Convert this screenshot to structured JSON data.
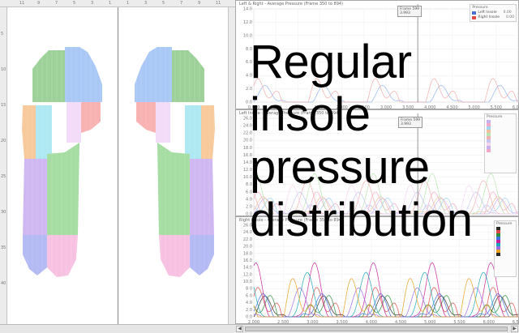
{
  "insole_map": {
    "top_ticks": [
      "11",
      "9",
      "7",
      "5",
      "3",
      "1",
      "1",
      "3",
      "5",
      "7",
      "9",
      "11"
    ],
    "left_ticks": [
      "5",
      "10",
      "15",
      "20",
      "25",
      "30",
      "35",
      "40"
    ],
    "zone_colors": {
      "toe_green": "#9ed19a",
      "toe_blue": "#a9c8f5",
      "met_orange": "#f8c99b",
      "met_cyan": "#aee8f2",
      "met_white": "#ffffff",
      "met_lavender": "#f2dcf7",
      "met_pink": "#f9b2b2",
      "mid_purple": "#cfb8f2",
      "mid_green": "#a5dda2",
      "heel_blue": "#b4baf3",
      "heel_pink": "#f7c2e2"
    }
  },
  "panes": {
    "top": {
      "title": "Left & Right - Average Pressure (Frame 350 to 894)",
      "y_ticks": [
        "14.0",
        "12.0",
        "10.0",
        "8.0",
        "6.0",
        "4.0",
        "2.0",
        "0.0"
      ],
      "x_ticks": [
        "0.000",
        "0.500",
        "1.000",
        "1.500",
        "2.000",
        "2.500",
        "3.000",
        "3.500",
        "4.000",
        "4.500",
        "5.000",
        "5.500",
        "6.000"
      ],
      "cursor_tip": [
        "Frame 599",
        "3.993"
      ],
      "legend_heading": "Pressure",
      "legend": [
        {
          "label": "Left Insole",
          "value": "0.00",
          "color": "#4a6fd8"
        },
        {
          "label": "Right Insole",
          "value": "0.00",
          "color": "#e04a4a"
        }
      ],
      "series_colors": [
        "#8fb3ee",
        "#f2a9a9"
      ]
    },
    "middle": {
      "title": "Left Insole - Average Pressure (Frame 350 to 894)",
      "y_ticks": [
        "26.0",
        "24.0",
        "22.0",
        "20.0",
        "18.0",
        "16.0",
        "14.0",
        "12.0",
        "10.0",
        "8.0",
        "6.0",
        "4.0",
        "2.0",
        "0.0"
      ],
      "cursor_tip": [
        "Frame 599",
        "3.993"
      ],
      "legend_heading": "Pressure",
      "series_colors": [
        "#c7b2f1",
        "#f3a8c8",
        "#9fd5f1",
        "#f1c09b",
        "#b9e3b0",
        "#f1b0b0",
        "#c4c4f1",
        "#f5d4ef"
      ]
    },
    "bottom": {
      "title": "Right Insole - Average Pressure (Frame 350 to 894)",
      "y_ticks": [
        "26.0",
        "24.0",
        "22.0",
        "20.0",
        "18.0",
        "16.0",
        "14.0",
        "12.0",
        "10.0",
        "8.0",
        "6.0",
        "4.0",
        "2.0",
        "0.0"
      ],
      "x_ticks": [
        "2.000",
        "2.500",
        "3.000",
        "3.500",
        "4.000",
        "4.500",
        "5.000",
        "5.500",
        "6.000",
        "6.500"
      ],
      "legend_heading": "Pressure",
      "series_colors": [
        "#2b2b2b",
        "#e04848",
        "#2a8f3c",
        "#3f6fe0",
        "#c6209f",
        "#1aa7b8",
        "#9a6ae6",
        "#e8a01e"
      ]
    }
  },
  "caption": {
    "lines": [
      "Regular",
      "insole",
      "pressure",
      "distribution"
    ]
  }
}
